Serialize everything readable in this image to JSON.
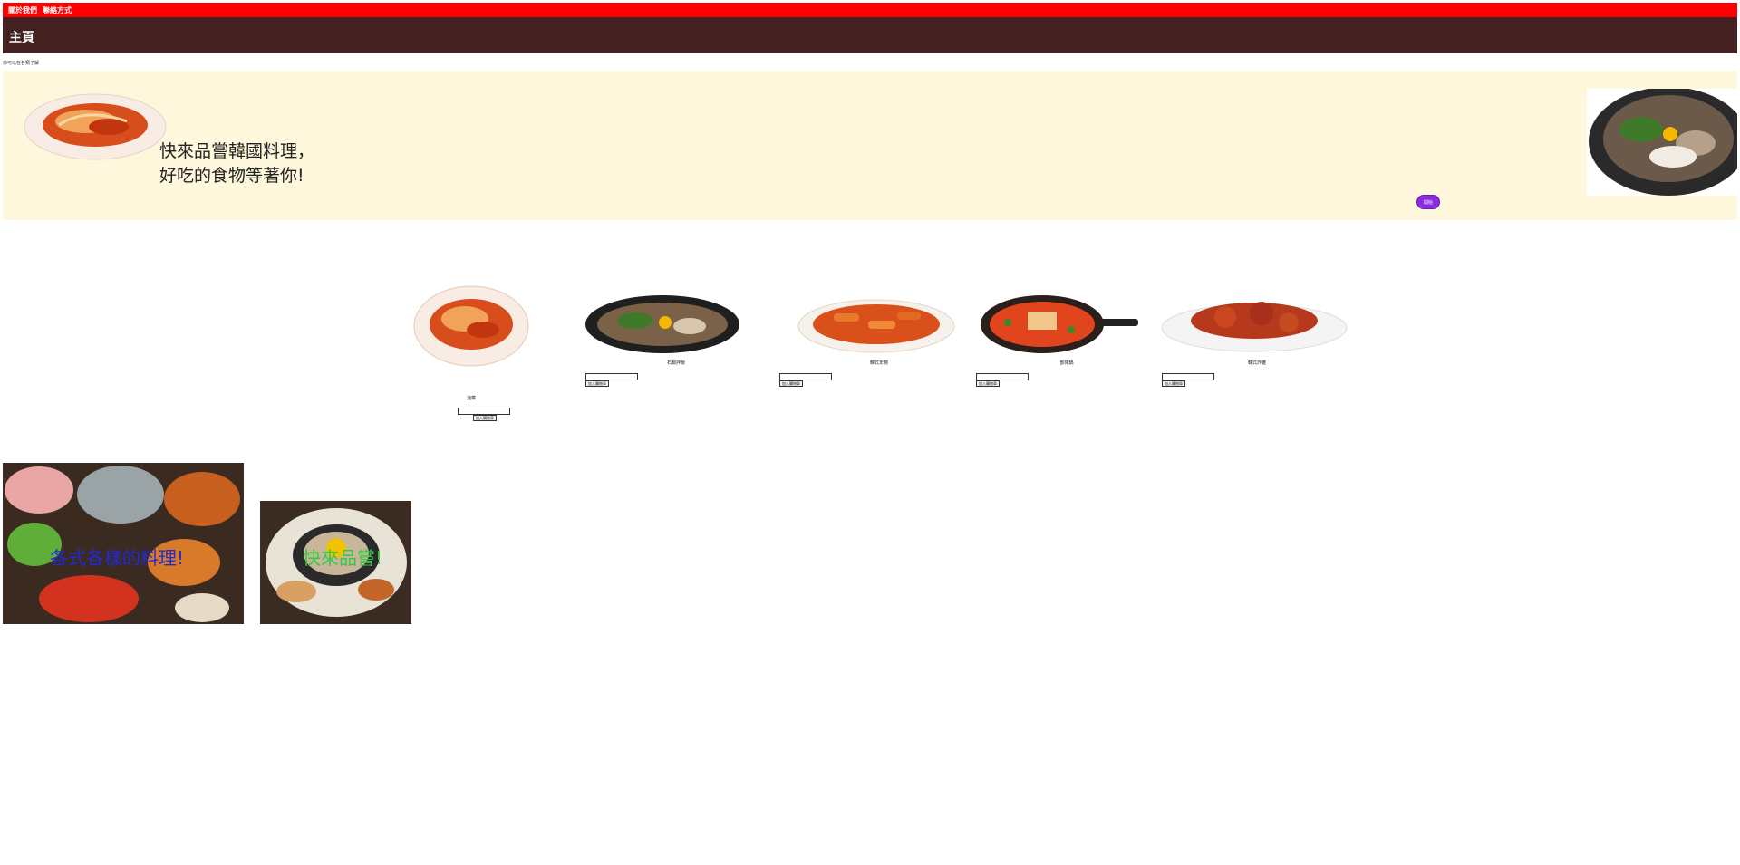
{
  "nav": {
    "items": [
      {
        "label": "關於我們"
      },
      {
        "label": "聯絡方式"
      }
    ]
  },
  "header": {
    "title": "主頁"
  },
  "breadcrumb": {
    "text": "你可以在各類了解"
  },
  "hero": {
    "line1": "快來品嘗韓國料理，",
    "line2": "好吃的食物等著你!",
    "button_label": "開始"
  },
  "menu": {
    "add_label": "加入購物車",
    "items": [
      {
        "name": "泡菜"
      },
      {
        "name": "石鍋拌飯"
      },
      {
        "name": "韓式年糕"
      },
      {
        "name": "部隊鍋"
      },
      {
        "name": "韓式炸雞"
      }
    ]
  },
  "promos": [
    {
      "caption": "各式各樣的料理!",
      "caption_color": "#1f2bd6"
    },
    {
      "caption": "快來品嘗!",
      "caption_color": "#2ecc40"
    }
  ],
  "colors": {
    "nav_bg": "#ff0000",
    "header_bg": "#452020",
    "hero_bg": "#fff7dc",
    "button_purple": "#8a2be2"
  }
}
